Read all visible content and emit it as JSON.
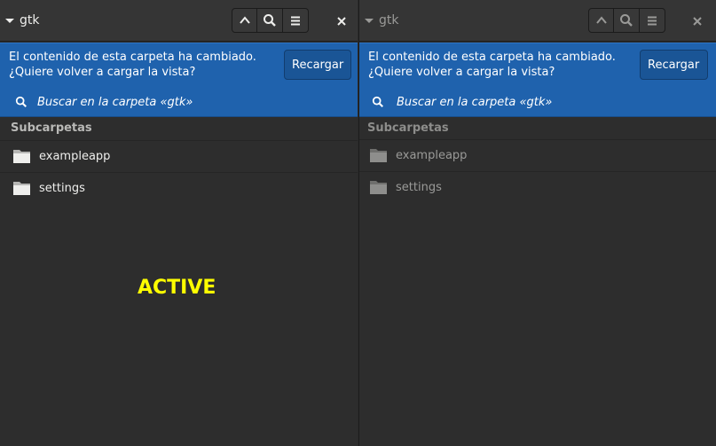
{
  "panels": [
    {
      "title": "gtk",
      "infobar": {
        "line1": "El contenido de esta carpeta ha cambiado.",
        "line2": "¿Quiere volver a cargar la vista?",
        "reload_label": "Recargar"
      },
      "search": {
        "placeholder": "Buscar en la carpeta «gtk»"
      },
      "section_title": "Subcarpetas",
      "folders": [
        {
          "name": "exampleapp"
        },
        {
          "name": "settings"
        }
      ],
      "status_label": "ACTIVE"
    },
    {
      "title": "gtk",
      "infobar": {
        "line1": "El contenido de esta carpeta ha cambiado.",
        "line2": "¿Quiere volver a cargar la vista?",
        "reload_label": "Recargar"
      },
      "search": {
        "placeholder": "Buscar en la carpeta «gtk»"
      },
      "section_title": "Subcarpetas",
      "folders": [
        {
          "name": "exampleapp"
        },
        {
          "name": "settings"
        }
      ]
    }
  ],
  "icons": {
    "dropdown": "pan-down-icon",
    "up": "go-up-icon",
    "search": "search-icon",
    "menu": "open-menu-icon",
    "close": "close-icon",
    "folder": "folder-icon"
  },
  "colors": {
    "infobar": "#1f62ad",
    "status_label": "#ffff00",
    "background": "#2d2d2d"
  }
}
